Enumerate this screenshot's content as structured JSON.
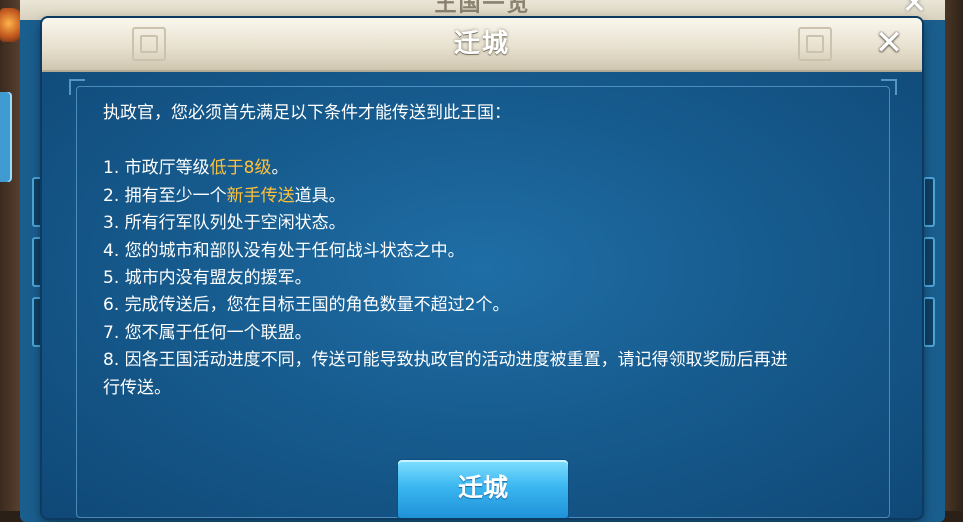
{
  "background_panel": {
    "title": "王国一览",
    "close_glyph": "✕"
  },
  "dialog": {
    "title": "迁城",
    "close_glyph": "✕",
    "intro": "执政官，您必须首先满足以下条件才能传送到此王国：",
    "conditions": [
      {
        "pre": "1. 市政厅等级",
        "highlight": "低于8级",
        "post": "。"
      },
      {
        "pre": "2. 拥有至少一个",
        "highlight": "新手传送",
        "post": "道具。"
      },
      {
        "pre": "3. 所有行军队列处于空闲状态。"
      },
      {
        "pre": "4. 您的城市和部队没有处于任何战斗状态之中。"
      },
      {
        "pre": "5. 城市内没有盟友的援军。"
      },
      {
        "pre": "6. 完成传送后，您在目标王国的角色数量不超过2个。"
      },
      {
        "pre": "7. 您不属于任何一个联盟。"
      },
      {
        "pre": "8. 因各王国活动进度不同，传送可能导致执政官的活动进度被重置，请记得领取奖励后再进",
        "line2": "行传送。"
      }
    ],
    "confirm_button": "迁城"
  },
  "colors": {
    "highlight": "#ffc13b",
    "panel_blue": "#175c8f",
    "button_blue": "#3ab6f0",
    "header_cream": "#e6dfcd"
  }
}
